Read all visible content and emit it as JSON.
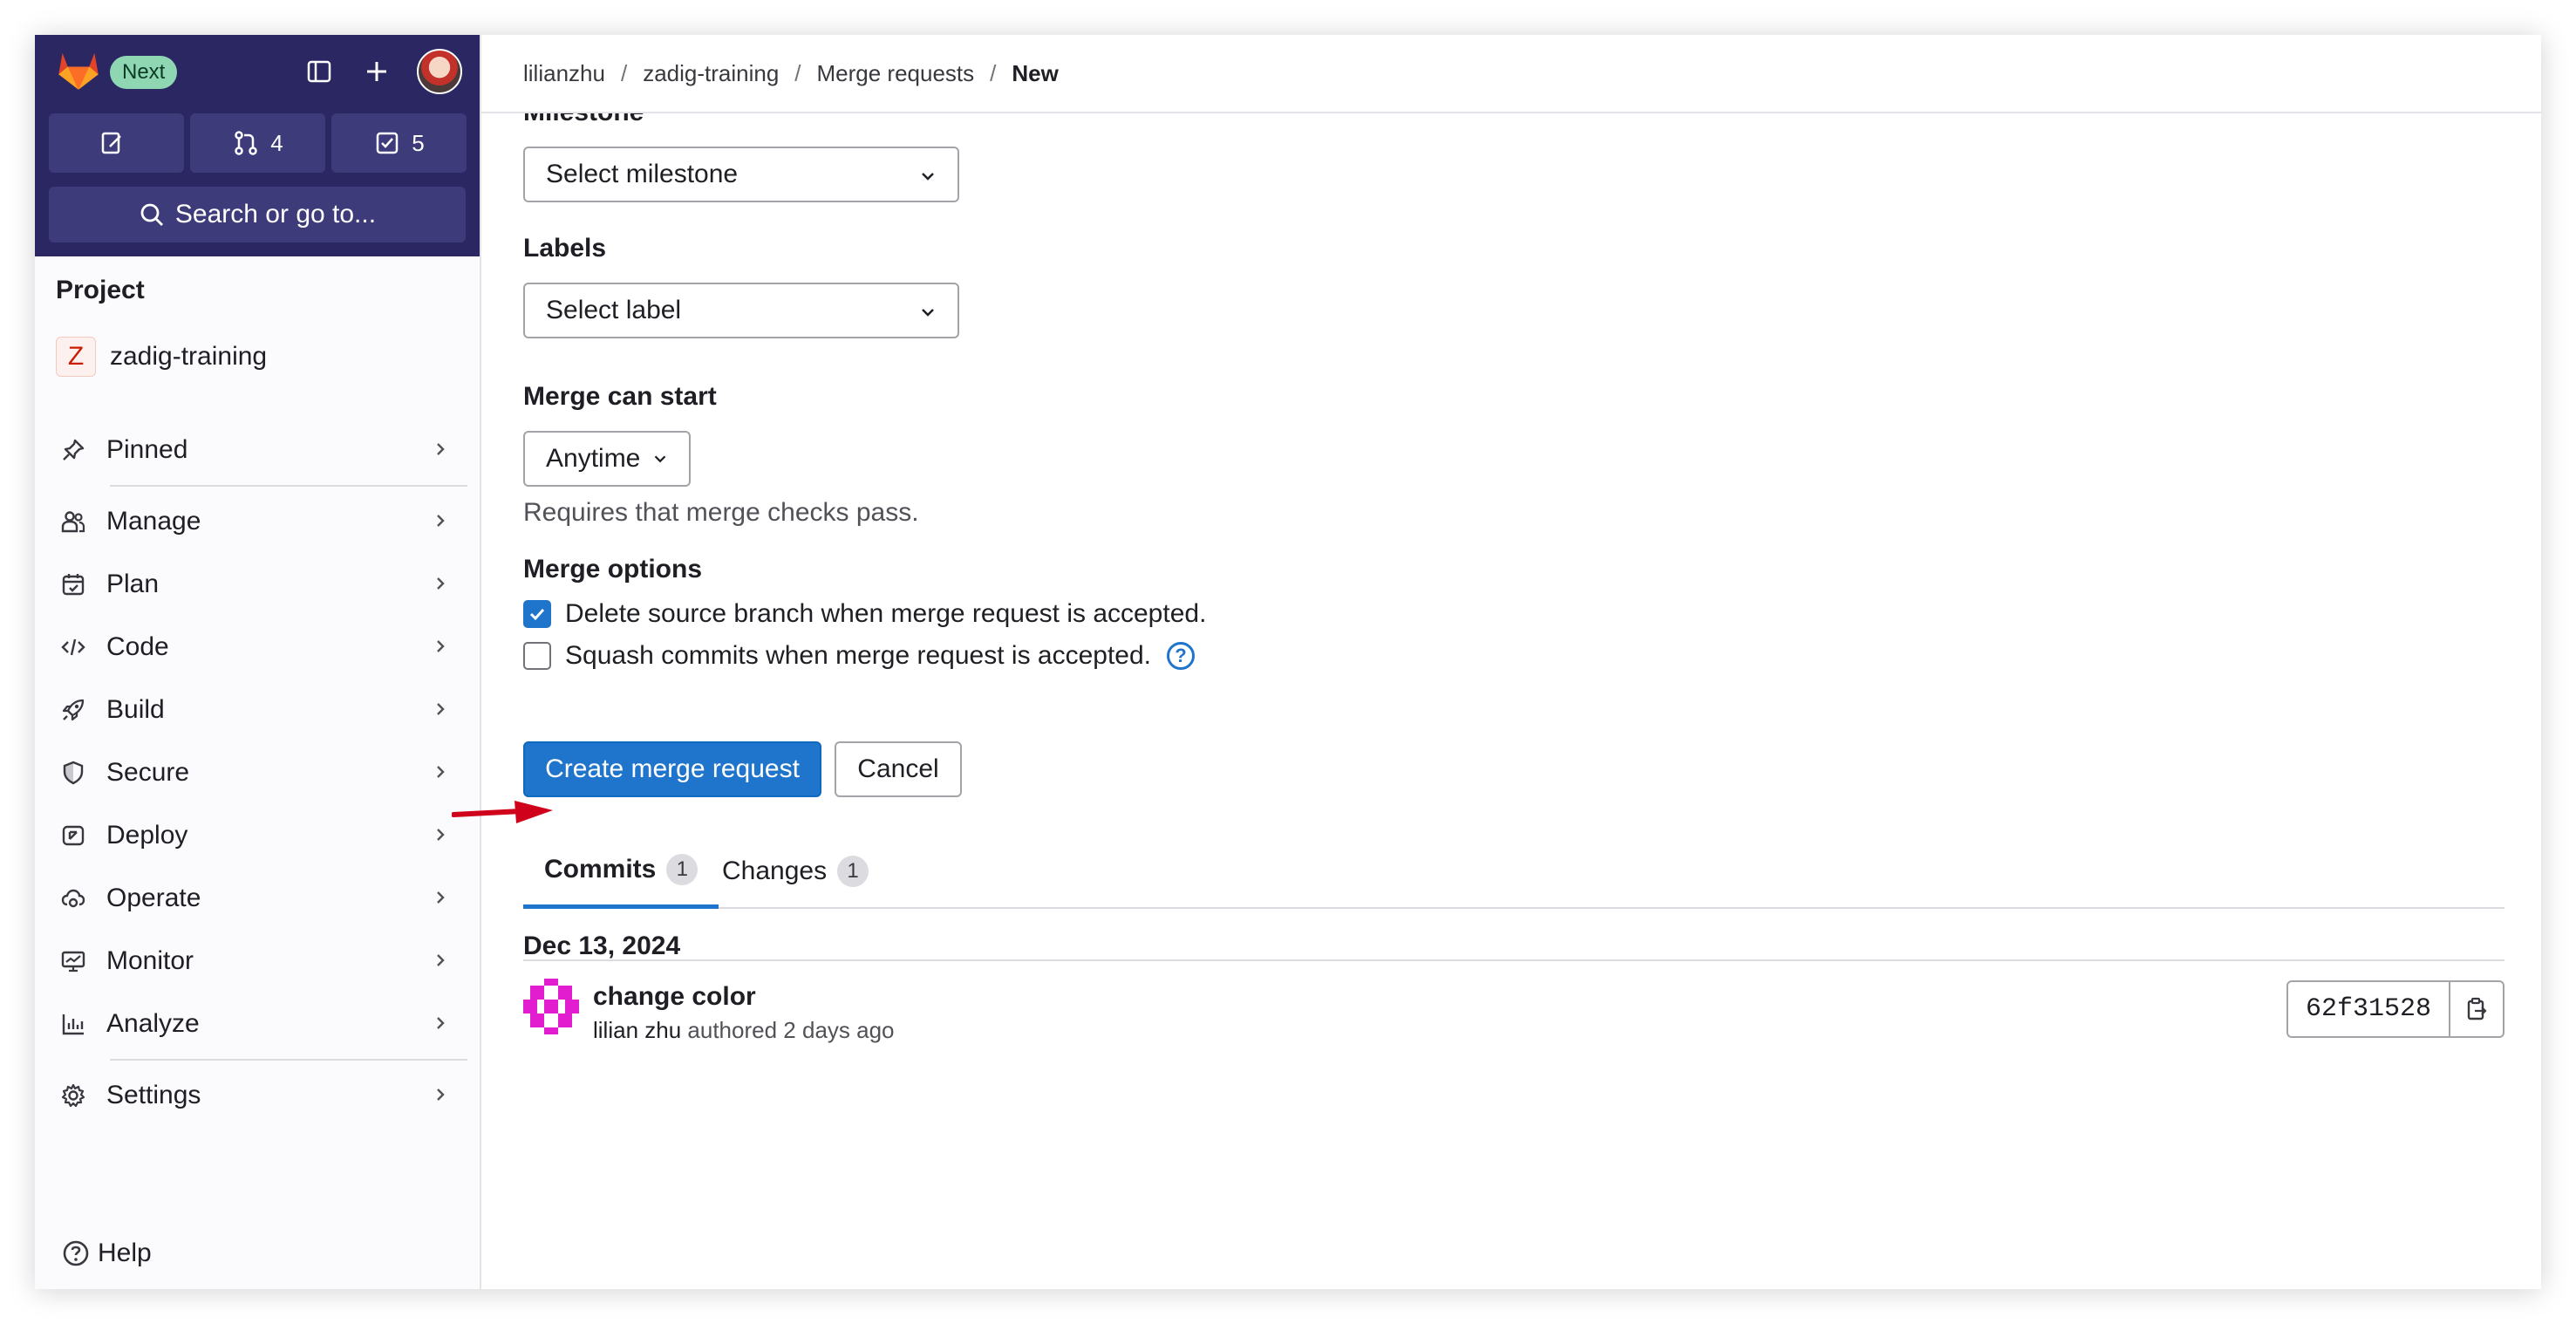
{
  "header": {
    "badge": "Next",
    "counters": [
      {
        "icon": "issues-icon",
        "count": ""
      },
      {
        "icon": "merge-request-icon",
        "count": "4"
      },
      {
        "icon": "todo-icon",
        "count": "5"
      }
    ],
    "search_label": "Search or go to..."
  },
  "sidebar": {
    "section_title": "Project",
    "project": {
      "initial": "Z",
      "name": "zadig-training"
    },
    "items": [
      {
        "label": "Pinned",
        "icon": "pin-icon"
      },
      {
        "label": "Manage",
        "icon": "users-icon"
      },
      {
        "label": "Plan",
        "icon": "calendar-icon"
      },
      {
        "label": "Code",
        "icon": "code-icon"
      },
      {
        "label": "Build",
        "icon": "rocket-icon"
      },
      {
        "label": "Secure",
        "icon": "shield-icon"
      },
      {
        "label": "Deploy",
        "icon": "deploy-icon"
      },
      {
        "label": "Operate",
        "icon": "cloud-gear-icon"
      },
      {
        "label": "Monitor",
        "icon": "monitor-icon"
      },
      {
        "label": "Analyze",
        "icon": "chart-icon"
      },
      {
        "label": "Settings",
        "icon": "gear-icon"
      }
    ],
    "help": "Help"
  },
  "breadcrumb": [
    "lilianzhu",
    "zadig-training",
    "Merge requests",
    "New"
  ],
  "form": {
    "milestone_label": "Milestone",
    "milestone_value": "Select milestone",
    "labels_label": "Labels",
    "labels_value": "Select label",
    "merge_start_label": "Merge can start",
    "merge_start_value": "Anytime",
    "merge_start_help": "Requires that merge checks pass.",
    "merge_options_label": "Merge options",
    "delete_branch": {
      "label": "Delete source branch when merge request is accepted.",
      "checked": true
    },
    "squash": {
      "label": "Squash commits when merge request is accepted.",
      "checked": false
    },
    "submit": "Create merge request",
    "cancel": "Cancel"
  },
  "tabs": [
    {
      "label": "Commits",
      "count": "1",
      "active": true
    },
    {
      "label": "Changes",
      "count": "1",
      "active": false
    }
  ],
  "commits": {
    "date": "Dec 13, 2024",
    "items": [
      {
        "title": "change color",
        "author": "lilian zhu",
        "action": "authored",
        "time": "2 days ago",
        "sha": "62f31528"
      }
    ]
  },
  "colors": {
    "sidebar_top": "#2a2763",
    "primary": "#1f75cb",
    "annotation_arrow": "#d0021b"
  }
}
